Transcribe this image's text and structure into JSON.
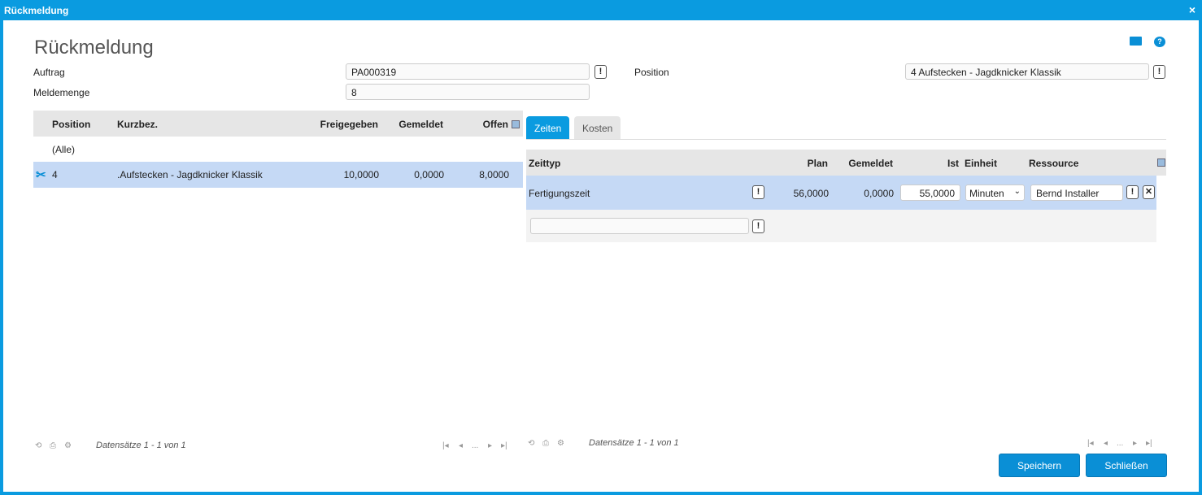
{
  "window": {
    "title": "Rückmeldung",
    "close": "×"
  },
  "page_title": "Rückmeldung",
  "form": {
    "auftrag_label": "Auftrag",
    "auftrag_value": "PA000319",
    "meldemenge_label": "Meldemenge",
    "meldemenge_value": "8",
    "position_label": "Position",
    "position_value": "4 Aufstecken - Jagdknicker Klassik",
    "exclaim": "!"
  },
  "left_grid": {
    "headers": [
      "Position",
      "Kurzbez.",
      "Freigegeben",
      "Gemeldet",
      "Offen"
    ],
    "all_row": "(Alle)",
    "rows": [
      {
        "position": "4",
        "kurzbez": ".Aufstecken - Jagdknicker Klassik",
        "freigegeben": "10,0000",
        "gemeldet": "0,0000",
        "offen": "8,0000"
      }
    ],
    "footer": "Datensätze 1 - 1 von 1",
    "pager_dots": "..."
  },
  "tabs": [
    {
      "label": "Zeiten",
      "active": true
    },
    {
      "label": "Kosten",
      "active": false
    }
  ],
  "right_grid": {
    "headers": [
      "Zeittyp",
      "Plan",
      "Gemeldet",
      "Ist",
      "Einheit",
      "Ressource"
    ],
    "rows": [
      {
        "zeittyp": "Fertigungszeit",
        "plan": "56,0000",
        "gemeldet": "0,0000",
        "ist": "55,0000",
        "einheit": "Minuten",
        "ressource": "Bernd Installer"
      }
    ],
    "new_row_value": "",
    "footer": "Datensätze 1 - 1 von 1",
    "pager_dots": "...",
    "delete": "✕"
  },
  "buttons": {
    "save": "Speichern",
    "close": "Schließen"
  },
  "colors": {
    "accent": "#0a9be0",
    "selected_row": "#c5d9f5"
  }
}
